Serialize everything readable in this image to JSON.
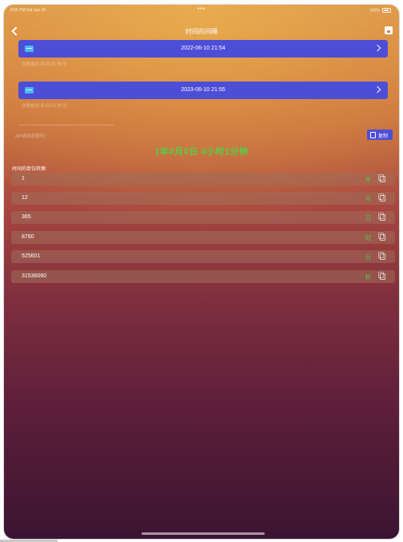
{
  "status_bar": {
    "time": "8:55 PM  Sat Jun 10",
    "dots": "•••",
    "battery": "100%"
  },
  "nav": {
    "title": "时间的间隔"
  },
  "date_rows": [
    {
      "date": "2022-06-10 21:54",
      "sub": "交换格式:年/月/日 时:分"
    },
    {
      "date": "2023-06-10 21:55",
      "sub": "交换格式:年/月/日 时:分"
    }
  ],
  "api_link": "API调用获取吗？",
  "copy_button": "复制",
  "result": "1年0月0日 0小时1分钟",
  "section_label": "时间的单位转换:",
  "units": [
    {
      "value": "1",
      "unit": "年"
    },
    {
      "value": "12",
      "unit": "月"
    },
    {
      "value": "365",
      "unit": "日"
    },
    {
      "value": "8760",
      "unit": "时"
    },
    {
      "value": "525601",
      "unit": "分"
    },
    {
      "value": "31536060",
      "unit": "秒"
    }
  ],
  "colors": {
    "accent": "#4d4ed8",
    "highlight": "#4fd14a",
    "calendar_icon": "#4ab6f0"
  }
}
